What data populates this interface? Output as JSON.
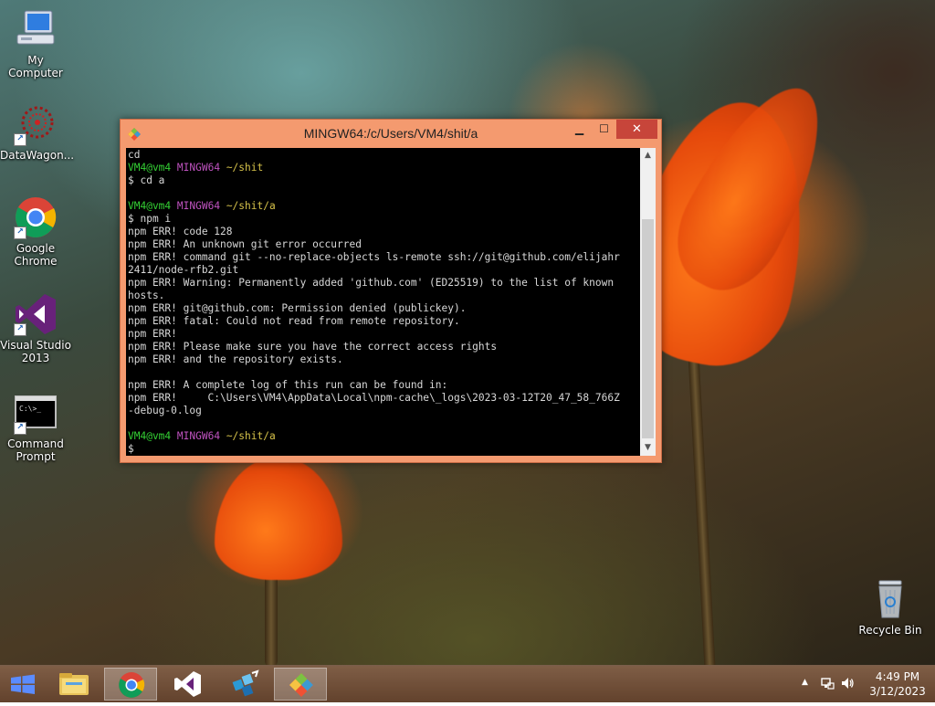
{
  "desktop": {
    "icons": [
      {
        "label": "My Computer"
      },
      {
        "label": "DataWagon..."
      },
      {
        "label": "Google Chrome"
      },
      {
        "label": "Visual Studio 2013"
      },
      {
        "label": "Command Prompt"
      },
      {
        "label": "Recycle Bin"
      }
    ]
  },
  "window": {
    "title": "MINGW64:/c/Users/VM4/shit/a",
    "buttons": {
      "minimize": "▁",
      "maximize": "☐",
      "close": "✕"
    }
  },
  "terminal": {
    "prompt_user": "VM4@vm4",
    "prompt_host": "MINGW64",
    "lines": [
      {
        "text": "cd"
      },
      {
        "prompt": true,
        "path": "~/shit"
      },
      {
        "text": "$ cd a"
      },
      {
        "text": ""
      },
      {
        "prompt": true,
        "path": "~/shit/a"
      },
      {
        "text": "$ npm i"
      },
      {
        "text": "npm ERR! code 128"
      },
      {
        "text": "npm ERR! An unknown git error occurred"
      },
      {
        "text": "npm ERR! command git --no-replace-objects ls-remote ssh://git@github.com/elijahr"
      },
      {
        "text": "2411/node-rfb2.git"
      },
      {
        "text": "npm ERR! Warning: Permanently added 'github.com' (ED25519) to the list of known"
      },
      {
        "text": "hosts."
      },
      {
        "text": "npm ERR! git@github.com: Permission denied (publickey)."
      },
      {
        "text": "npm ERR! fatal: Could not read from remote repository."
      },
      {
        "text": "npm ERR!"
      },
      {
        "text": "npm ERR! Please make sure you have the correct access rights"
      },
      {
        "text": "npm ERR! and the repository exists."
      },
      {
        "text": ""
      },
      {
        "text": "npm ERR! A complete log of this run can be found in:"
      },
      {
        "text": "npm ERR!     C:\\Users\\VM4\\AppData\\Local\\npm-cache\\_logs\\2023-03-12T20_47_58_766Z"
      },
      {
        "text": "-debug-0.log"
      },
      {
        "text": ""
      },
      {
        "prompt": true,
        "path": "~/shit/a"
      },
      {
        "text": "$"
      }
    ]
  },
  "taskbar": {
    "items": [
      {
        "name": "file-explorer"
      },
      {
        "name": "google-chrome"
      },
      {
        "name": "visual-studio"
      },
      {
        "name": "datawagon"
      },
      {
        "name": "git-bash"
      }
    ],
    "clock": {
      "time": "4:49 PM",
      "date": "3/12/2023"
    }
  }
}
